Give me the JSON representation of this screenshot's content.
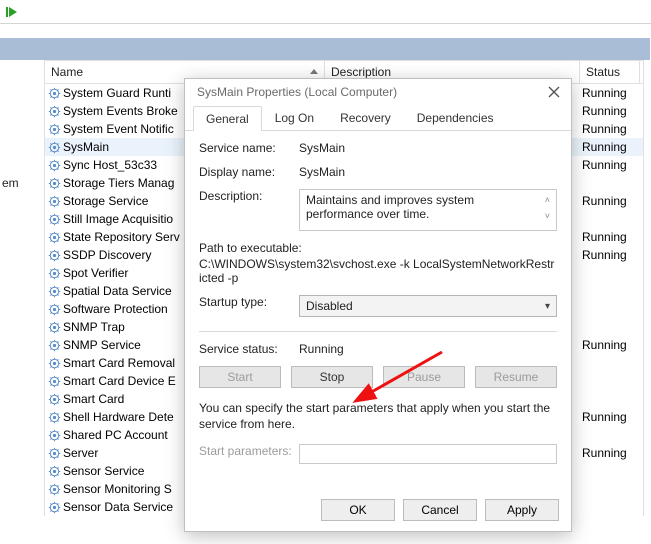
{
  "toolbar": {
    "play_icon": "play-icon"
  },
  "services_window": {
    "columns": {
      "name": "Name",
      "description": "Description",
      "status": "Status"
    },
    "left_stub": "em",
    "rows": [
      {
        "name": "System Guard Runti",
        "status": "Running"
      },
      {
        "name": "System Events Broke",
        "status": "Running"
      },
      {
        "name": "System Event Notific",
        "status": "Running"
      },
      {
        "name": "SysMain",
        "status": "Running",
        "selected": true
      },
      {
        "name": "Sync Host_53c33",
        "status": "Running"
      },
      {
        "name": "Storage Tiers Manag",
        "status": ""
      },
      {
        "name": "Storage Service",
        "status": "Running"
      },
      {
        "name": "Still Image Acquisitio",
        "status": ""
      },
      {
        "name": "State Repository Serv",
        "status": "Running"
      },
      {
        "name": "SSDP Discovery",
        "status": "Running"
      },
      {
        "name": "Spot Verifier",
        "status": ""
      },
      {
        "name": "Spatial Data Service",
        "status": ""
      },
      {
        "name": "Software Protection",
        "status": ""
      },
      {
        "name": "SNMP Trap",
        "status": ""
      },
      {
        "name": "SNMP Service",
        "status": "Running"
      },
      {
        "name": "Smart Card Removal",
        "status": ""
      },
      {
        "name": "Smart Card Device E",
        "status": ""
      },
      {
        "name": "Smart Card",
        "status": ""
      },
      {
        "name": "Shell Hardware Dete",
        "status": "Running"
      },
      {
        "name": "Shared PC Account",
        "status": ""
      },
      {
        "name": "Server",
        "status": "Running"
      },
      {
        "name": "Sensor Service",
        "status": ""
      },
      {
        "name": "Sensor Monitoring S",
        "status": ""
      },
      {
        "name": "Sensor Data Service",
        "status": ""
      }
    ]
  },
  "dialog": {
    "title": "SysMain Properties (Local Computer)",
    "tabs": {
      "general": "General",
      "logon": "Log On",
      "recovery": "Recovery",
      "dependencies": "Dependencies"
    },
    "labels": {
      "service_name": "Service name:",
      "display_name": "Display name:",
      "description": "Description:",
      "path": "Path to executable:",
      "startup_type": "Startup type:",
      "service_status": "Service status:",
      "start_parameters": "Start parameters:"
    },
    "values": {
      "service_name": "SysMain",
      "display_name": "SysMain",
      "description": "Maintains and improves system performance over time.",
      "path": "C:\\WINDOWS\\system32\\svchost.exe -k LocalSystemNetworkRestricted -p",
      "startup_type": "Disabled",
      "service_status": "Running",
      "start_parameters": ""
    },
    "note": "You can specify the start parameters that apply when you start the service from here.",
    "buttons": {
      "start": "Start",
      "stop": "Stop",
      "pause": "Pause",
      "resume": "Resume",
      "ok": "OK",
      "cancel": "Cancel",
      "apply": "Apply"
    }
  }
}
